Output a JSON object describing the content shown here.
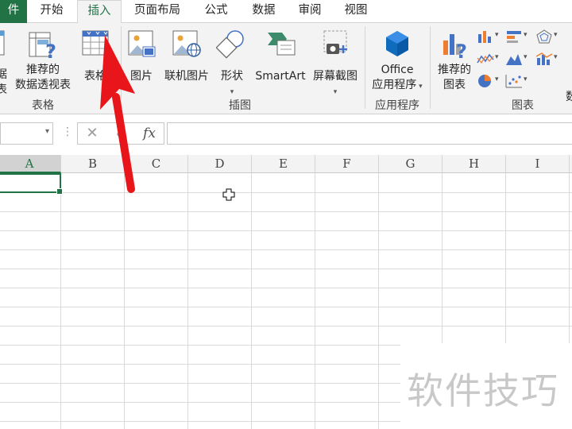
{
  "tabs": [
    {
      "label": "件",
      "type": "file"
    },
    {
      "label": "开始"
    },
    {
      "label": "插入",
      "active": true
    },
    {
      "label": "页面布局"
    },
    {
      "label": "公式"
    },
    {
      "label": "数据"
    },
    {
      "label": "审阅"
    },
    {
      "label": "视图"
    }
  ],
  "ribbon": {
    "partial_left_top": "据",
    "partial_left_bottom": "表",
    "recommended_pivot_line1": "推荐的",
    "recommended_pivot_line2": "数据透视表",
    "table_label": "表格",
    "group_tables": "表格",
    "pictures": "图片",
    "online_pictures": "联机图片",
    "shapes": "形状",
    "smartart": "SmartArt",
    "screenshot": "屏幕截图",
    "group_illustrations": "插图",
    "office_apps_line1": "Office",
    "office_apps_line2": "应用程序",
    "group_apps": "应用程序",
    "recommended_charts_line1": "推荐的",
    "recommended_charts_line2": "图表",
    "group_charts": "图表",
    "partial_right": "数"
  },
  "formula_bar": {
    "cancel": "✕",
    "enter": "✓",
    "fx": "fx",
    "name_box": "",
    "formula": ""
  },
  "columns": [
    "A",
    "B",
    "C",
    "D",
    "E",
    "F",
    "G",
    "H",
    "I"
  ],
  "selected_cell": "A",
  "watermark": "软件技巧",
  "colors": {
    "accent": "#217346",
    "arrow": "#e8161b"
  }
}
